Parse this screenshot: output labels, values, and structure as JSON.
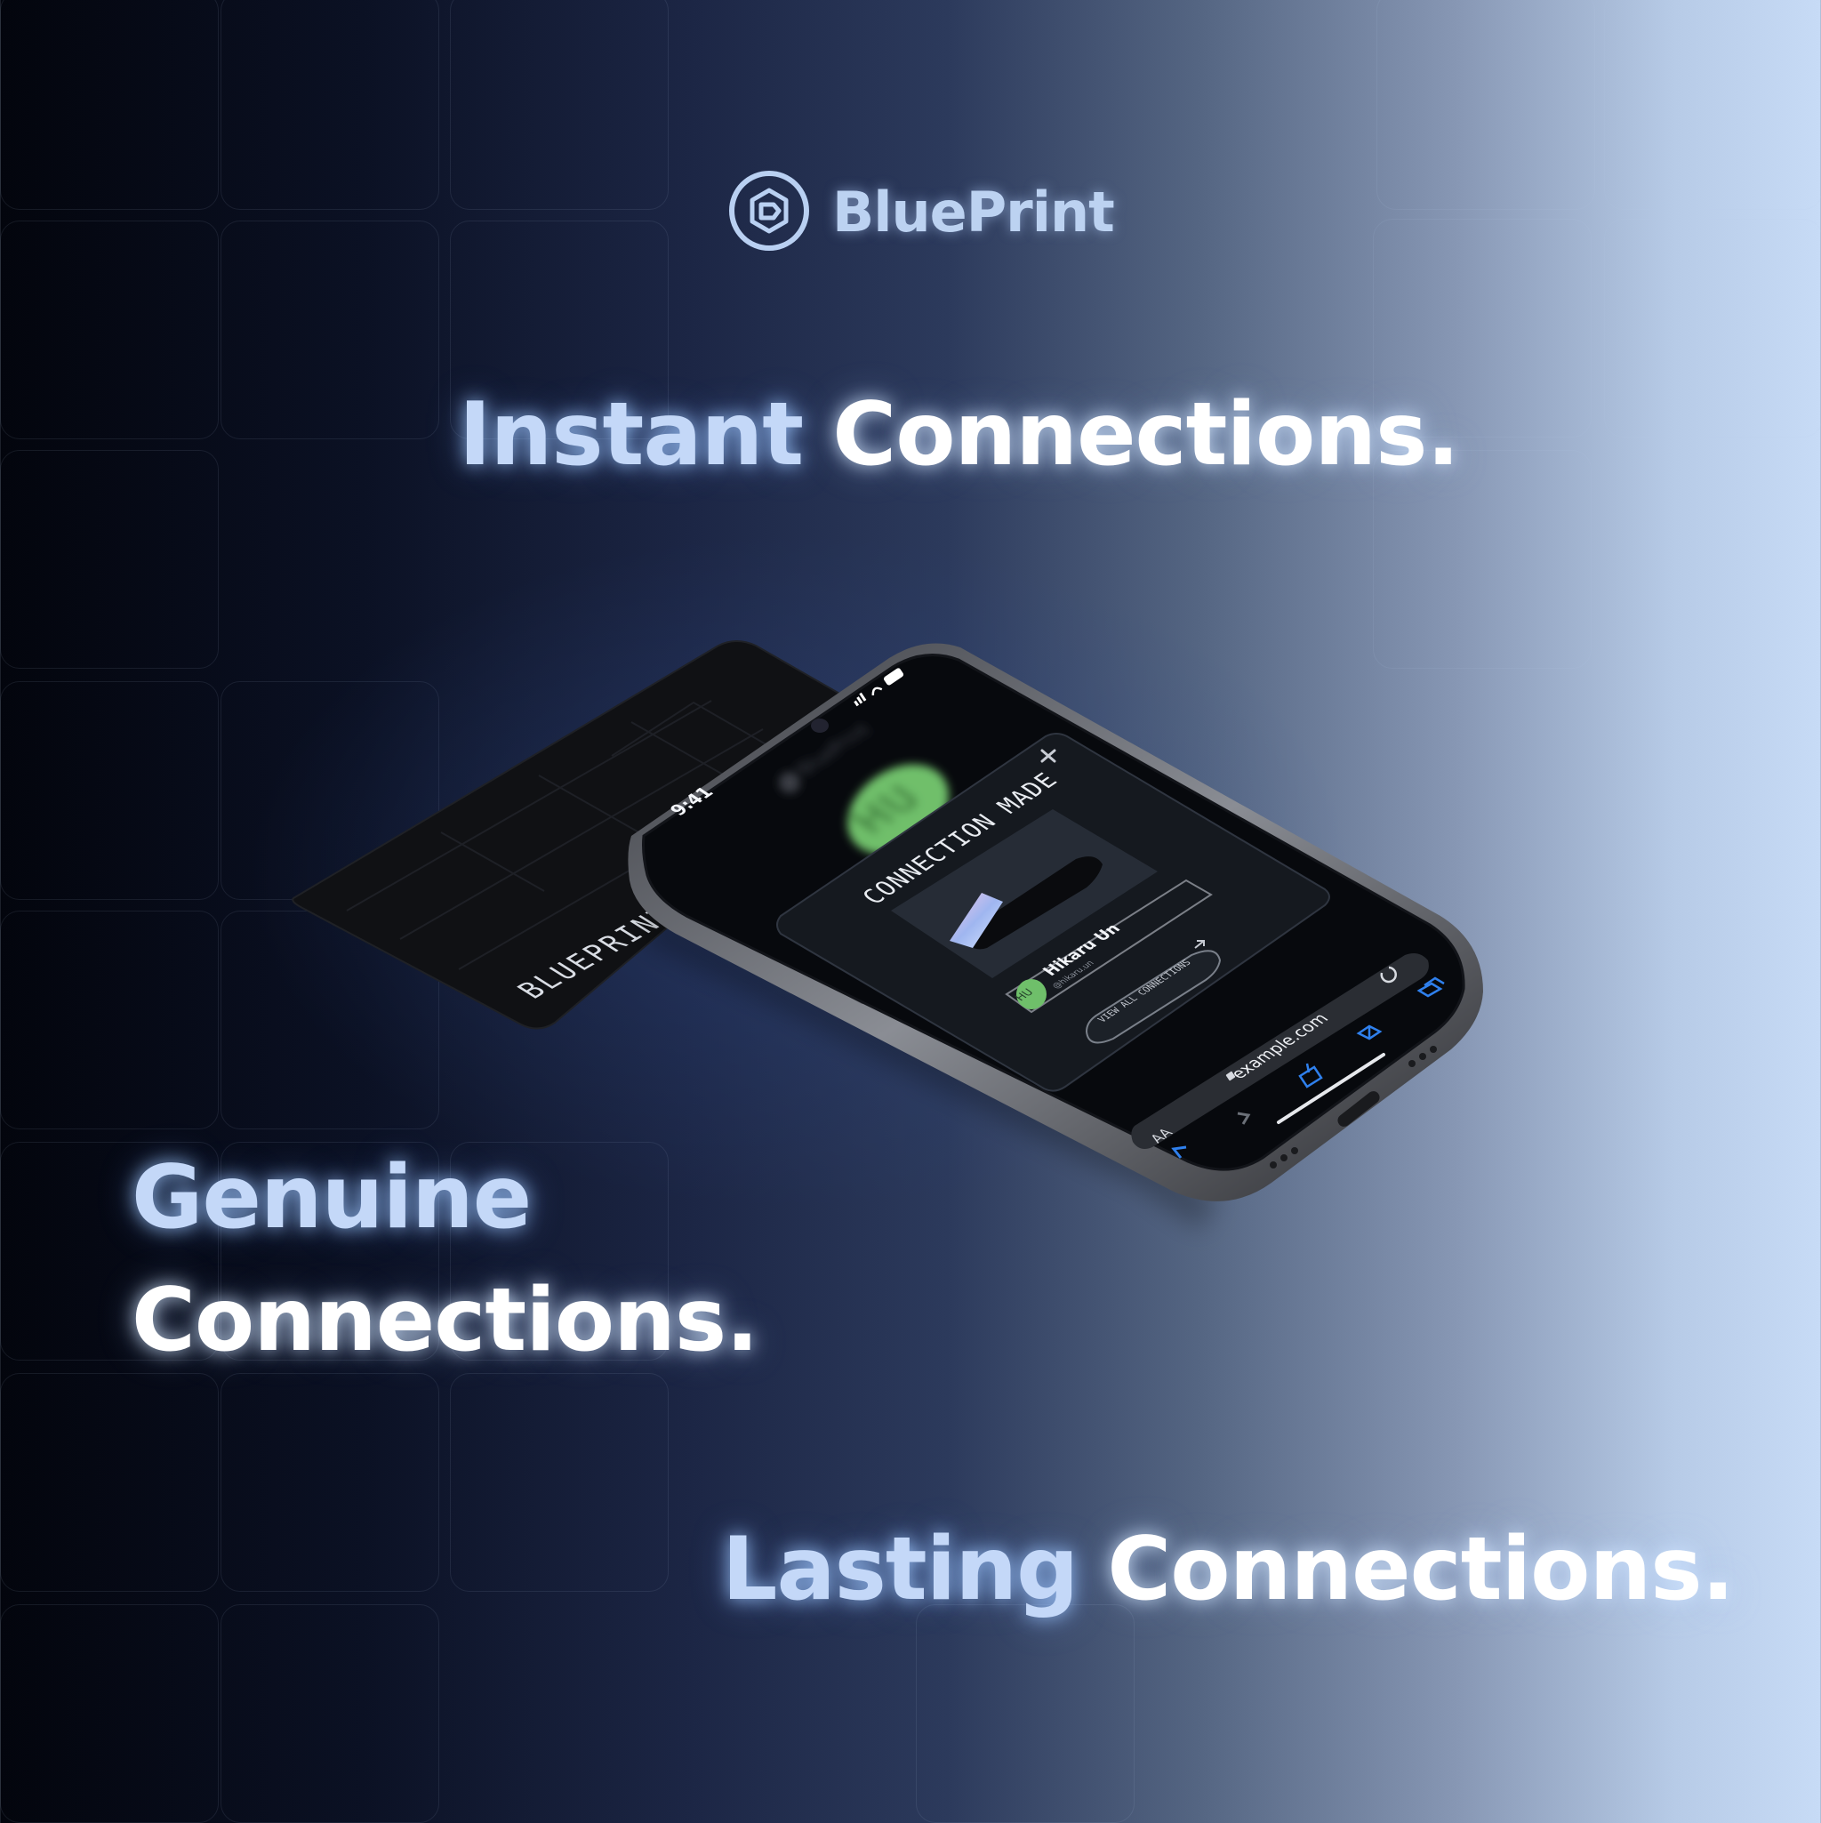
{
  "brand": {
    "name": "BluePrint",
    "logo_icon": "blueprint-hexagon-icon"
  },
  "headlines": {
    "instant": {
      "word": "Instant",
      "rest": "Connections."
    },
    "genuine": {
      "word": "Genuine",
      "rest": "Connections."
    },
    "lasting": {
      "word": "Lasting",
      "rest": "Connections."
    }
  },
  "card": {
    "label": "BLUEPRINT"
  },
  "phone": {
    "status_bar": {
      "time": "9:41"
    },
    "background_app": {
      "header": "BluePrint",
      "avatar_initials": "HU"
    },
    "modal": {
      "title": "CONNECTION MADE",
      "close_icon": "close-icon",
      "contact": {
        "initials": "HU",
        "name": "Hikaru Un",
        "handle": "@hikaru.un"
      },
      "view_all_label": "VIEW ALL CONNECTIONS",
      "view_all_icon": "arrow-up-right-icon"
    },
    "browser": {
      "text_size_label": "AA",
      "url": "example.com",
      "lock_icon": "lock-icon",
      "reload_icon": "reload-icon",
      "back_icon": "chevron-left-icon",
      "forward_icon": "chevron-right-icon",
      "share_icon": "share-icon",
      "bookmarks_icon": "book-icon",
      "tabs_icon": "tabs-icon"
    }
  },
  "colors": {
    "headline_blue": "#c4d8f8",
    "headline_white": "#ffffff",
    "avatar_green": "#6fbf6a",
    "ios_blue": "#2f80ed"
  }
}
